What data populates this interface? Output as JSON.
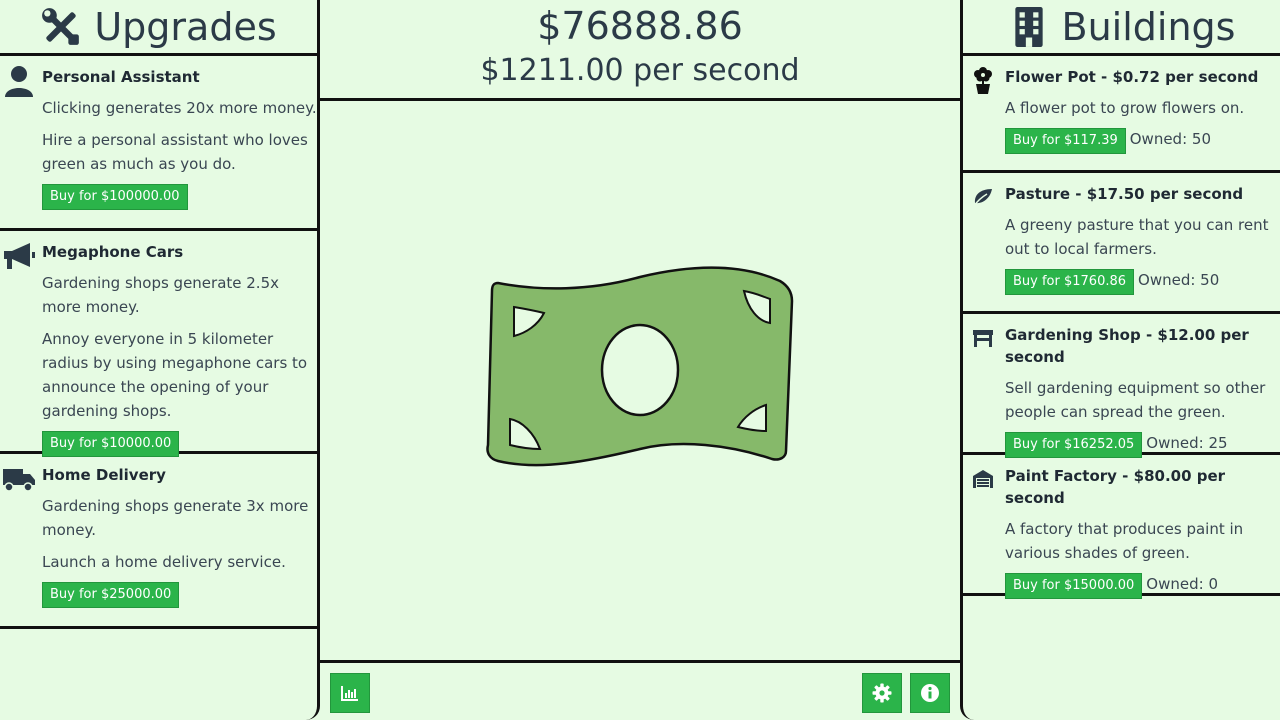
{
  "upgrades": {
    "title": "Upgrades",
    "items": [
      {
        "icon": "user-icon",
        "title": "Personal Assistant",
        "effect": "Clicking generates 20x more money.",
        "description": "Hire a personal assistant who loves green as much as you do.",
        "buy_label": "Buy for $100000.00"
      },
      {
        "icon": "megaphone-icon",
        "title": "Megaphone Cars",
        "effect": "Gardening shops generate 2.5x more money.",
        "description": "Annoy everyone in 5 kilometer radius by using megaphone cars to announce the opening of your gardening shops.",
        "buy_label": "Buy for $10000.00"
      },
      {
        "icon": "truck-icon",
        "title": "Home Delivery",
        "effect": "Gardening shops generate 3x more money.",
        "description": "Launch a home delivery service.",
        "buy_label": "Buy for $25000.00"
      }
    ]
  },
  "stats": {
    "money": "$76888.86",
    "rate": "$1211.00 per second"
  },
  "buildings": {
    "title": "Buildings",
    "items": [
      {
        "icon": "flower-pot-icon",
        "title": "Flower Pot - $0.72 per second",
        "description": "A flower pot to grow flowers on.",
        "buy_label": "Buy for $117.39",
        "owned": "Owned: 50"
      },
      {
        "icon": "leaf-icon",
        "title": "Pasture - $17.50 per second",
        "description": "A greeny pasture that you can rent out to local farmers.",
        "buy_label": "Buy for $1760.86",
        "owned": "Owned: 50"
      },
      {
        "icon": "store-icon",
        "title": "Gardening Shop - $12.00 per second",
        "description": "Sell gardening equipment so other people can spread the green.",
        "buy_label": "Buy for $16252.05",
        "owned": "Owned: 25"
      },
      {
        "icon": "warehouse-icon",
        "title": "Paint Factory - $80.00 per second",
        "description": "A factory that produces paint in various shades of green.",
        "buy_label": "Buy for $15000.00",
        "owned": "Owned: 0"
      }
    ]
  },
  "colors": {
    "background": "#e6fbe3",
    "button": "#2bb44a",
    "bill": "#86b96a",
    "text": "#2b3a47"
  },
  "toolbar": {
    "stats_icon": "chart-icon",
    "settings_icon": "gear-icon",
    "info_icon": "info-icon"
  }
}
